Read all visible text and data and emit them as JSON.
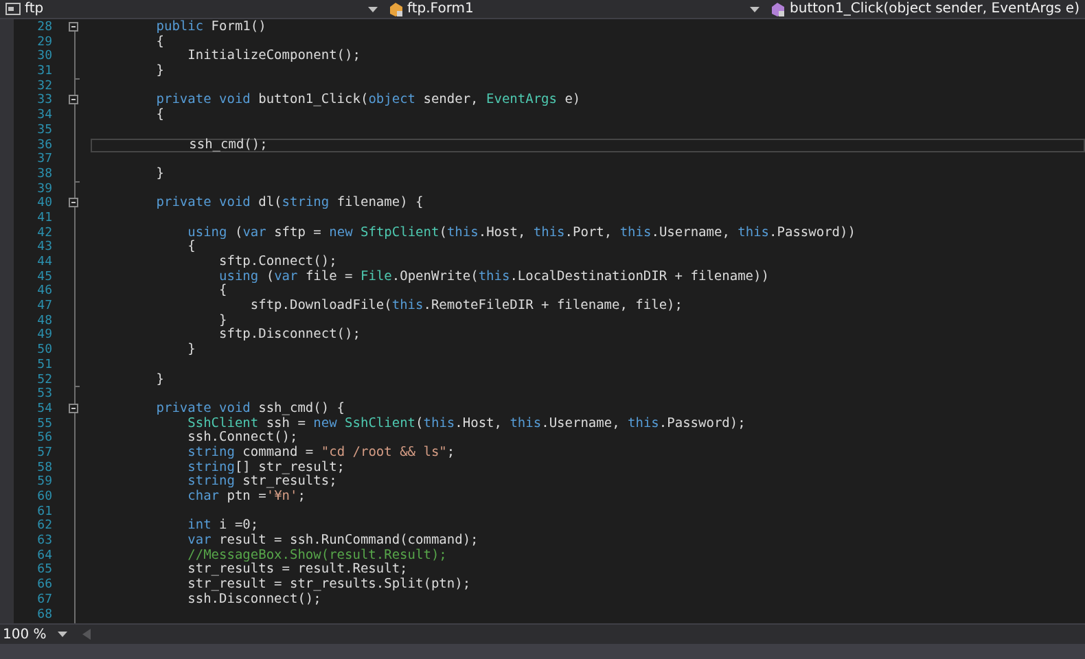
{
  "navigation": [
    {
      "kind": "project",
      "text": "ftp"
    },
    {
      "kind": "class",
      "text": "ftp.Form1"
    },
    {
      "kind": "method",
      "text": "button1_Click(object sender, EventArgs e)"
    }
  ],
  "lines": [
    {
      "number": "28",
      "current": false,
      "expanded": true,
      "tokens": [
        {
          "kind": "kw",
          "text": "        public"
        },
        {
          "kind": "plain",
          "text": " Form1()"
        }
      ]
    },
    {
      "number": "29",
      "current": false,
      "tokens": [
        {
          "kind": "plain",
          "text": "        {"
        }
      ]
    },
    {
      "number": "30",
      "current": false,
      "tokens": [
        {
          "kind": "plain",
          "text": "            InitializeComponent();"
        }
      ]
    },
    {
      "number": "31",
      "current": false,
      "fold_end": true,
      "tokens": [
        {
          "kind": "plain",
          "text": "        }"
        }
      ]
    },
    {
      "number": "32",
      "current": false
    },
    {
      "number": "33",
      "current": false,
      "expanded": true,
      "tokens": [
        {
          "kind": "kw",
          "text": "        private void"
        },
        {
          "kind": "plain",
          "text": " button1_Click("
        },
        {
          "kind": "kw",
          "text": "object"
        },
        {
          "kind": "plain",
          "text": " sender, "
        },
        {
          "kind": "type",
          "text": "EventArgs"
        },
        {
          "kind": "plain",
          "text": " e)"
        }
      ]
    },
    {
      "number": "34",
      "current": false,
      "tokens": [
        {
          "kind": "plain",
          "text": "        {"
        }
      ]
    },
    {
      "number": "35",
      "current": false
    },
    {
      "number": "36",
      "current": true,
      "tokens": [
        {
          "kind": "plain",
          "text": "            ssh_cmd();"
        }
      ]
    },
    {
      "number": "37",
      "current": false
    },
    {
      "number": "38",
      "current": false,
      "fold_end": true,
      "tokens": [
        {
          "kind": "plain",
          "text": "        }"
        }
      ]
    },
    {
      "number": "39",
      "current": false
    },
    {
      "number": "40",
      "current": false,
      "expanded": true,
      "tokens": [
        {
          "kind": "kw",
          "text": "        private void"
        },
        {
          "kind": "plain",
          "text": " dl("
        },
        {
          "kind": "kw",
          "text": "string"
        },
        {
          "kind": "plain",
          "text": " filename) {"
        }
      ]
    },
    {
      "number": "41",
      "current": false
    },
    {
      "number": "42",
      "current": false,
      "tokens": [
        {
          "kind": "kw",
          "text": "            using"
        },
        {
          "kind": "plain",
          "text": " ("
        },
        {
          "kind": "kw",
          "text": "var"
        },
        {
          "kind": "plain",
          "text": " sftp = "
        },
        {
          "kind": "kw",
          "text": "new"
        },
        {
          "kind": "type",
          "text": " SftpClient"
        },
        {
          "kind": "plain",
          "text": "("
        },
        {
          "kind": "kw",
          "text": "this"
        },
        {
          "kind": "plain",
          "text": ".Host, "
        },
        {
          "kind": "kw",
          "text": "this"
        },
        {
          "kind": "plain",
          "text": ".Port, "
        },
        {
          "kind": "kw",
          "text": "this"
        },
        {
          "kind": "plain",
          "text": ".Username, "
        },
        {
          "kind": "kw",
          "text": "this"
        },
        {
          "kind": "plain",
          "text": ".Password))"
        }
      ]
    },
    {
      "number": "43",
      "current": false,
      "tokens": [
        {
          "kind": "plain",
          "text": "            {"
        }
      ]
    },
    {
      "number": "44",
      "current": false,
      "tokens": [
        {
          "kind": "plain",
          "text": "                sftp.Connect();"
        }
      ]
    },
    {
      "number": "45",
      "current": false,
      "tokens": [
        {
          "kind": "kw",
          "text": "                using"
        },
        {
          "kind": "plain",
          "text": " ("
        },
        {
          "kind": "kw",
          "text": "var"
        },
        {
          "kind": "plain",
          "text": " file = "
        },
        {
          "kind": "type",
          "text": "File"
        },
        {
          "kind": "plain",
          "text": ".OpenWrite("
        },
        {
          "kind": "kw",
          "text": "this"
        },
        {
          "kind": "plain",
          "text": ".LocalDestinationDIR + filename))"
        }
      ]
    },
    {
      "number": "46",
      "current": false,
      "tokens": [
        {
          "kind": "plain",
          "text": "                {"
        }
      ]
    },
    {
      "number": "47",
      "current": false,
      "tokens": [
        {
          "kind": "plain",
          "text": "                    sftp.DownloadFile("
        },
        {
          "kind": "kw",
          "text": "this"
        },
        {
          "kind": "plain",
          "text": ".RemoteFileDIR + filename, file);"
        }
      ]
    },
    {
      "number": "48",
      "current": false,
      "tokens": [
        {
          "kind": "plain",
          "text": "                }"
        }
      ]
    },
    {
      "number": "49",
      "current": false,
      "tokens": [
        {
          "kind": "plain",
          "text": "                sftp.Disconnect();"
        }
      ]
    },
    {
      "number": "50",
      "current": false,
      "tokens": [
        {
          "kind": "plain",
          "text": "            }"
        }
      ]
    },
    {
      "number": "51",
      "current": false
    },
    {
      "number": "52",
      "current": false,
      "fold_end": true,
      "tokens": [
        {
          "kind": "plain",
          "text": "        }"
        }
      ]
    },
    {
      "number": "53",
      "current": false
    },
    {
      "number": "54",
      "current": false,
      "expanded": true,
      "tokens": [
        {
          "kind": "kw",
          "text": "        private void"
        },
        {
          "kind": "plain",
          "text": " ssh_cmd() {"
        }
      ]
    },
    {
      "number": "55",
      "current": false,
      "tokens": [
        {
          "kind": "type",
          "text": "            SshClient"
        },
        {
          "kind": "plain",
          "text": " ssh = "
        },
        {
          "kind": "kw",
          "text": "new"
        },
        {
          "kind": "type",
          "text": " SshClient"
        },
        {
          "kind": "plain",
          "text": "("
        },
        {
          "kind": "kw",
          "text": "this"
        },
        {
          "kind": "plain",
          "text": ".Host, "
        },
        {
          "kind": "kw",
          "text": "this"
        },
        {
          "kind": "plain",
          "text": ".Username, "
        },
        {
          "kind": "kw",
          "text": "this"
        },
        {
          "kind": "plain",
          "text": ".Password);"
        }
      ]
    },
    {
      "number": "56",
      "current": false,
      "tokens": [
        {
          "kind": "plain",
          "text": "            ssh.Connect();"
        }
      ]
    },
    {
      "number": "57",
      "current": false,
      "tokens": [
        {
          "kind": "kw",
          "text": "            string"
        },
        {
          "kind": "plain",
          "text": " command = "
        },
        {
          "kind": "str",
          "text": "\"cd /root && ls\""
        },
        {
          "kind": "plain",
          "text": ";"
        }
      ]
    },
    {
      "number": "58",
      "current": false,
      "tokens": [
        {
          "kind": "kw",
          "text": "            string"
        },
        {
          "kind": "plain",
          "text": "[] str_result;"
        }
      ]
    },
    {
      "number": "59",
      "current": false,
      "tokens": [
        {
          "kind": "kw",
          "text": "            string"
        },
        {
          "kind": "plain",
          "text": " str_results;"
        }
      ]
    },
    {
      "number": "60",
      "current": false,
      "tokens": [
        {
          "kind": "kw",
          "text": "            char"
        },
        {
          "kind": "plain",
          "text": " ptn ="
        },
        {
          "kind": "str",
          "text": "'¥n'"
        },
        {
          "kind": "plain",
          "text": ";"
        }
      ]
    },
    {
      "number": "61",
      "current": false
    },
    {
      "number": "62",
      "current": false,
      "tokens": [
        {
          "kind": "kw",
          "text": "            int"
        },
        {
          "kind": "plain",
          "text": " i =0;"
        }
      ]
    },
    {
      "number": "63",
      "current": false,
      "tokens": [
        {
          "kind": "kw",
          "text": "            var"
        },
        {
          "kind": "plain",
          "text": " result = ssh.RunCommand(command);"
        }
      ]
    },
    {
      "number": "64",
      "current": false,
      "tokens": [
        {
          "kind": "comment",
          "text": "            //MessageBox.Show(result.Result);"
        }
      ]
    },
    {
      "number": "65",
      "current": false,
      "tokens": [
        {
          "kind": "plain",
          "text": "            str_results = result.Result;"
        }
      ]
    },
    {
      "number": "66",
      "current": false,
      "tokens": [
        {
          "kind": "plain",
          "text": "            str_result = str_results.Split(ptn);"
        }
      ]
    },
    {
      "number": "67",
      "current": false,
      "tokens": [
        {
          "kind": "plain",
          "text": "            ssh.Disconnect();"
        }
      ]
    },
    {
      "number": "68",
      "current": false
    }
  ],
  "zoom": {
    "text": "100 %"
  }
}
